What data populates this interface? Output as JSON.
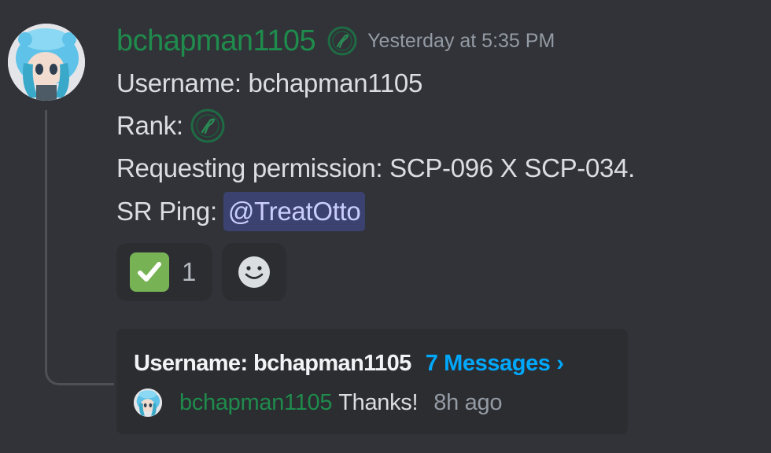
{
  "message": {
    "author": "bchapman1105",
    "timestamp": "Yesterday at 5:35 PM",
    "lines": {
      "username": "Username: bchapman1105",
      "rank_label": "Rank:",
      "request": "Requesting permission: SCP-096 X SCP-034.",
      "ping_label": "SR Ping:",
      "mention": "@TreatOtto"
    },
    "avatar_icon": "anime-avatar-icon",
    "badge_icon": "role-badge-icon"
  },
  "reactions": [
    {
      "emoji": "white-check-mark-icon",
      "count": "1"
    },
    {
      "emoji": "add-reaction-icon"
    }
  ],
  "thread": {
    "name": "Username: bchapman1105",
    "message_count": "7 Messages ›",
    "last_message": {
      "author": "bchapman1105",
      "text": "Thanks!",
      "time": "8h ago"
    }
  },
  "colors": {
    "background": "#313338",
    "username": "#1f8b4c",
    "mention_bg": "#3c4270",
    "link": "#00a8fc",
    "check_green": "#77b255"
  }
}
